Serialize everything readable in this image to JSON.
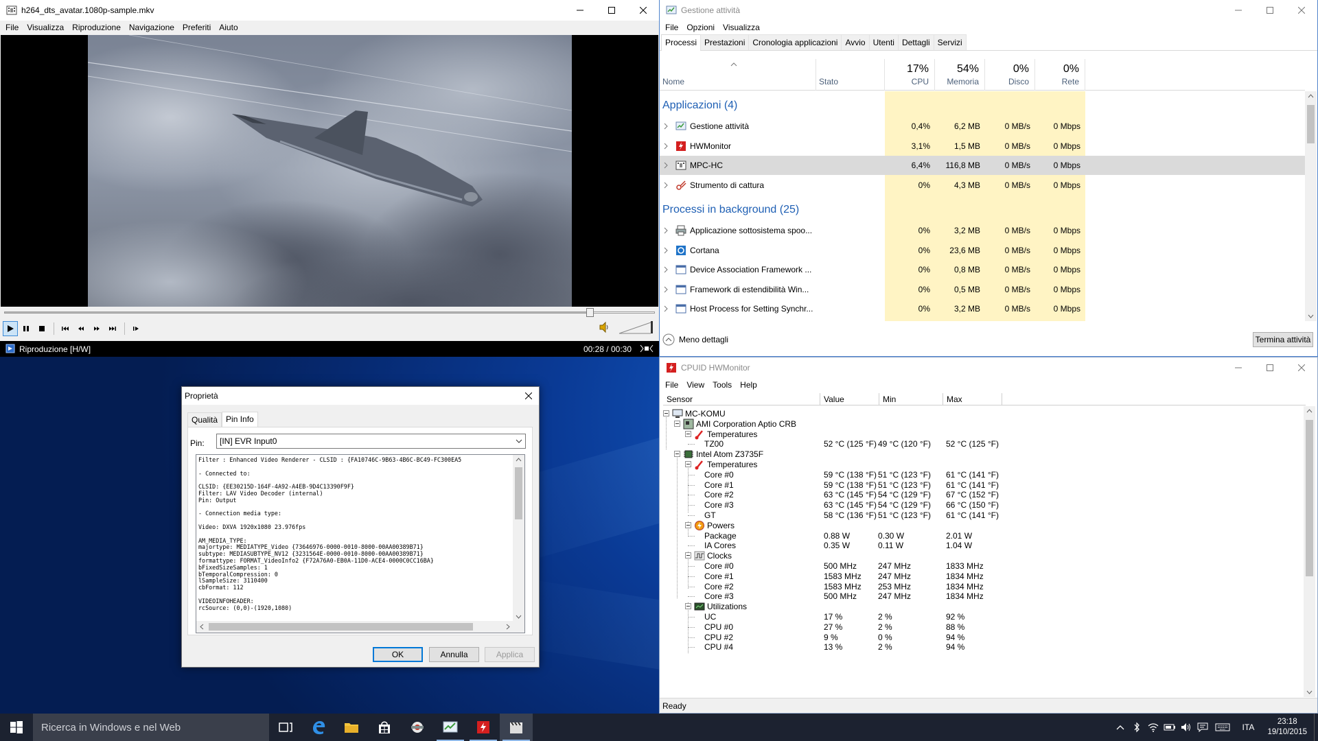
{
  "mpc": {
    "title": "h264_dts_avatar.1080p-sample.mkv",
    "menu": [
      "File",
      "Visualizza",
      "Riproduzione",
      "Navigazione",
      "Preferiti",
      "Aiuto"
    ],
    "status_left": "Riproduzione [H/W]",
    "time": "00:28 / 00:30",
    "seek_progress": 0.9,
    "volume_level": 1.0
  },
  "taskmgr": {
    "title": "Gestione attività",
    "menu": [
      "File",
      "Opzioni",
      "Visualizza"
    ],
    "tabs": [
      "Processi",
      "Prestazioni",
      "Cronologia applicazioni",
      "Avvio",
      "Utenti",
      "Dettagli",
      "Servizi"
    ],
    "headers": {
      "name": "Nome",
      "status": "Stato",
      "cpu_pct": "17%",
      "cpu": "CPU",
      "mem_pct": "54%",
      "mem": "Memoria",
      "disk_pct": "0%",
      "disk": "Disco",
      "net_pct": "0%",
      "net": "Rete"
    },
    "group_apps": "Applicazioni (4)",
    "group_bg": "Processi in background (25)",
    "apps": [
      {
        "name": "Gestione attività",
        "cpu": "0,4%",
        "mem": "6,2 MB",
        "disk": "0 MB/s",
        "net": "0 Mbps",
        "icon": "taskmgr-icon"
      },
      {
        "name": "HWMonitor",
        "cpu": "3,1%",
        "mem": "1,5 MB",
        "disk": "0 MB/s",
        "net": "0 Mbps",
        "icon": "hwmonitor-icon"
      },
      {
        "name": "MPC-HC",
        "cpu": "6,4%",
        "mem": "116,8 MB",
        "disk": "0 MB/s",
        "net": "0 Mbps",
        "icon": "mpc-icon"
      },
      {
        "name": "Strumento di cattura",
        "cpu": "0%",
        "mem": "4,3 MB",
        "disk": "0 MB/s",
        "net": "0 Mbps",
        "icon": "snipping-icon"
      }
    ],
    "background": [
      {
        "name": "Applicazione sottosistema spoo...",
        "cpu": "0%",
        "mem": "3,2 MB",
        "disk": "0 MB/s",
        "net": "0 Mbps",
        "icon": "printer-icon"
      },
      {
        "name": "Cortana",
        "cpu": "0%",
        "mem": "23,6 MB",
        "disk": "0 MB/s",
        "net": "0 Mbps",
        "icon": "cortana-icon"
      },
      {
        "name": "Device Association Framework ...",
        "cpu": "0%",
        "mem": "0,8 MB",
        "disk": "0 MB/s",
        "net": "0 Mbps",
        "icon": "process-icon"
      },
      {
        "name": "Framework di estendibilità Win...",
        "cpu": "0%",
        "mem": "0,5 MB",
        "disk": "0 MB/s",
        "net": "0 Mbps",
        "icon": "process-icon"
      },
      {
        "name": "Host Process for Setting Synchr...",
        "cpu": "0%",
        "mem": "3,2 MB",
        "disk": "0 MB/s",
        "net": "0 Mbps",
        "icon": "process-icon"
      }
    ],
    "fewer_details": "Meno dettagli",
    "end_task": "Termina attività"
  },
  "hwmon": {
    "title": "CPUID HWMonitor",
    "menu": [
      "File",
      "View",
      "Tools",
      "Help"
    ],
    "columns": [
      "Sensor",
      "Value",
      "Min",
      "Max"
    ],
    "status": "Ready",
    "rows": [
      {
        "label": "MC-KOMU",
        "level": 0,
        "icon": "computer-icon",
        "exp": true
      },
      {
        "label": "AMI Corporation Aptio CRB",
        "level": 1,
        "icon": "board-icon",
        "exp": true
      },
      {
        "label": "Temperatures",
        "level": 2,
        "icon": "thermometer-icon",
        "exp": true
      },
      {
        "label": "TZ00",
        "level": 3,
        "value": "52 °C  (125 °F)",
        "min": "49 °C  (120 °F)",
        "max": "52 °C  (125 °F)"
      },
      {
        "label": "Intel Atom Z3735F",
        "level": 1,
        "icon": "chip-icon",
        "exp": true
      },
      {
        "label": "Temperatures",
        "level": 2,
        "icon": "thermometer-icon",
        "exp": true
      },
      {
        "label": "Core #0",
        "level": 3,
        "value": "59 °C  (138 °F)",
        "min": "51 °C  (123 °F)",
        "max": "61 °C  (141 °F)"
      },
      {
        "label": "Core #1",
        "level": 3,
        "value": "59 °C  (138 °F)",
        "min": "51 °C  (123 °F)",
        "max": "61 °C  (141 °F)"
      },
      {
        "label": "Core #2",
        "level": 3,
        "value": "63 °C  (145 °F)",
        "min": "54 °C  (129 °F)",
        "max": "67 °C  (152 °F)"
      },
      {
        "label": "Core #3",
        "level": 3,
        "value": "63 °C  (145 °F)",
        "min": "54 °C  (129 °F)",
        "max": "66 °C  (150 °F)"
      },
      {
        "label": "GT",
        "level": 3,
        "value": "58 °C  (136 °F)",
        "min": "51 °C  (123 °F)",
        "max": "61 °C  (141 °F)"
      },
      {
        "label": "Powers",
        "level": 2,
        "icon": "power-icon",
        "exp": true
      },
      {
        "label": "Package",
        "level": 3,
        "value": "0.88 W",
        "min": "0.30 W",
        "max": "2.01 W"
      },
      {
        "label": "IA Cores",
        "level": 3,
        "value": "0.35 W",
        "min": "0.11 W",
        "max": "1.04 W"
      },
      {
        "label": "Clocks",
        "level": 2,
        "icon": "clock-wave-icon",
        "exp": true
      },
      {
        "label": "Core #0",
        "level": 3,
        "value": "500 MHz",
        "min": "247 MHz",
        "max": "1833 MHz"
      },
      {
        "label": "Core #1",
        "level": 3,
        "value": "1583 MHz",
        "min": "247 MHz",
        "max": "1834 MHz"
      },
      {
        "label": "Core #2",
        "level": 3,
        "value": "1583 MHz",
        "min": "253 MHz",
        "max": "1834 MHz"
      },
      {
        "label": "Core #3",
        "level": 3,
        "value": "500 MHz",
        "min": "247 MHz",
        "max": "1834 MHz"
      },
      {
        "label": "Utilizations",
        "level": 2,
        "icon": "util-icon",
        "exp": true
      },
      {
        "label": "UC",
        "level": 3,
        "value": "17 %",
        "min": "2 %",
        "max": "92 %"
      },
      {
        "label": "CPU #0",
        "level": 3,
        "value": "27 %",
        "min": "2 %",
        "max": "88 %"
      },
      {
        "label": "CPU #2",
        "level": 3,
        "value": "9 %",
        "min": "0 %",
        "max": "94 %"
      },
      {
        "label": "CPU #4",
        "level": 3,
        "value": "13 %",
        "min": "2 %",
        "max": "94 %"
      }
    ]
  },
  "dialog": {
    "title": "Proprietà",
    "tabs": [
      "Qualità",
      "Pin Info"
    ],
    "pin_label": "Pin:",
    "pin_value": "[IN] EVR Input0",
    "info_text": "Filter : Enhanced Video Renderer - CLSID : {FA10746C-9B63-4B6C-BC49-FC300EA5\n\n- Connected to:\n\nCLSID: {EE30215D-164F-4A92-A4EB-9D4C13390F9F}\nFilter: LAV Video Decoder (internal)\nPin: Output\n\n- Connection media type:\n\nVideo: DXVA 1920x1080 23.976fps\n\nAM_MEDIA_TYPE:\nmajortype: MEDIATYPE_Video {73646976-0000-0010-8000-00AA00389B71}\nsubtype: MEDIASUBTYPE_NV12 {3231564E-0000-0010-8000-00AA00389B71}\nformattype: FORMAT_VideoInfo2 {F72A76A0-EB0A-11D0-ACE4-0000C0CC16BA}\nbFixedSizeSamples: 1\nbTemporalCompression: 0\nlSampleSize: 3110400\ncbFormat: 112\n\nVIDEOINFOHEADER:\nrcSource: (0,0)-(1920,1080)",
    "ok": "OK",
    "cancel": "Annulla",
    "apply": "Applica"
  },
  "taskbar": {
    "search_placeholder": "Ricerca in Windows e nel Web",
    "lang": "ITA",
    "time": "23:18",
    "date": "19/10/2015"
  }
}
